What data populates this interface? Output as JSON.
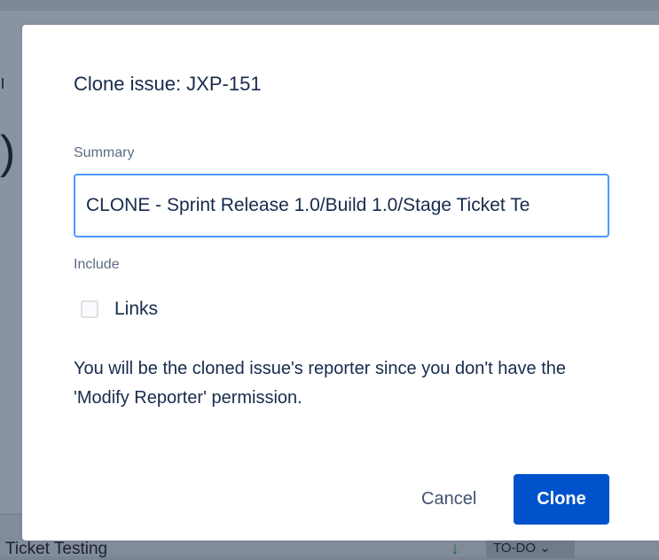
{
  "background": {
    "row_text": "Ticket Testing",
    "status_badge": "TO-DO ⌄",
    "arrow_icon": "arrow-down-icon"
  },
  "modal": {
    "title": "Clone issue: JXP-151",
    "summary_label": "Summary",
    "summary_value": "CLONE - Sprint Release 1.0/Build 1.0/Stage Ticket Te",
    "include_label": "Include",
    "links_checkbox": {
      "label": "Links",
      "checked": false
    },
    "info_text": "You will be the cloned issue's reporter since you don't have the 'Modify Reporter' permission.",
    "cancel_label": "Cancel",
    "clone_label": "Clone"
  },
  "colors": {
    "primary": "#0052cc",
    "focus_border": "#4c9aff",
    "text": "#172b4d",
    "label": "#5e6c84"
  }
}
